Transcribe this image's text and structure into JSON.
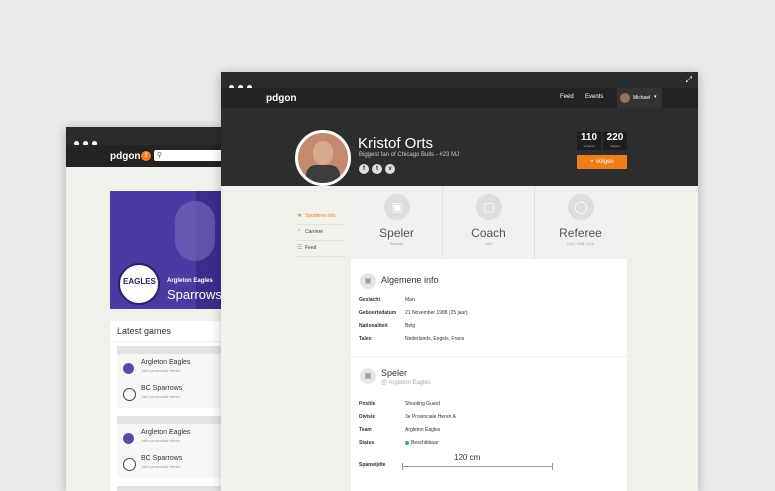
{
  "back_window": {
    "logo": {
      "main": "pdgon",
      "accent": ""
    },
    "badge": "2",
    "search_icon": "search-icon",
    "hero": {
      "club_name": "Argleton Eagles",
      "title": "Sparrows",
      "logo_text": "EAGLES"
    },
    "latest_games": {
      "title": "Latest games",
      "games": [
        {
          "home": "Argleton Eagles",
          "home_sub": "1ste provinciale heren",
          "away": "BC Sparrows",
          "away_sub": "1ste provinciale heren"
        },
        {
          "home": "Argleton Eagles",
          "home_sub": "1ste provinciale heren",
          "away": "BC Sparrows",
          "away_sub": "1ste provinciale heren"
        }
      ]
    }
  },
  "front_window": {
    "logo": {
      "main": "pdgon"
    },
    "nav": {
      "feed": "Feed",
      "events": "Events",
      "user": "Michael"
    },
    "profile": {
      "name": "Kristof Orts",
      "tagline": "Biggest fan of Chicago Bulls - #23 MJ",
      "social": [
        "f",
        "t",
        "v"
      ],
      "followers": {
        "value": "110",
        "label": "Volgend"
      },
      "following": {
        "value": "220",
        "label": "Volgers"
      },
      "follow_button": "+ Volgen"
    },
    "side_menu": [
      "Sportieve info",
      "Carriere",
      "Feed"
    ],
    "roles": [
      {
        "title": "Speler",
        "sub": "Seniors",
        "icon": "shirt-icon"
      },
      {
        "title": "Coach",
        "sub": "U13",
        "icon": "clipboard-icon"
      },
      {
        "title": "Referee",
        "sub": "U12, U16, U18",
        "icon": "whistle-icon"
      }
    ],
    "general_info": {
      "title": "Algemene info",
      "rows": [
        {
          "k": "Geslacht",
          "v": "Man"
        },
        {
          "k": "Geboortedatum",
          "v": "21 November 1988 (25 jaar)"
        },
        {
          "k": "Nationaliteit",
          "v": "Belg"
        },
        {
          "k": "Talen",
          "v": "Nederlands, Engels, Frans"
        }
      ]
    },
    "player_info": {
      "title": "Speler",
      "sub": "@ Argleton Eagles",
      "rows": [
        {
          "k": "Positie",
          "v": "Shooting Guard"
        },
        {
          "k": "Divisie",
          "v": "3e Provinciale Heren A"
        },
        {
          "k": "Team",
          "v": "Argleton Eagles"
        },
        {
          "k": "Status",
          "v": "Beschikbaar"
        }
      ],
      "span_label": "Spanwijdte",
      "span_value": "120 cm"
    }
  },
  "colors": {
    "accent": "#f07d1c",
    "dark": "#2d2d2d",
    "status": "#3cb34a"
  }
}
